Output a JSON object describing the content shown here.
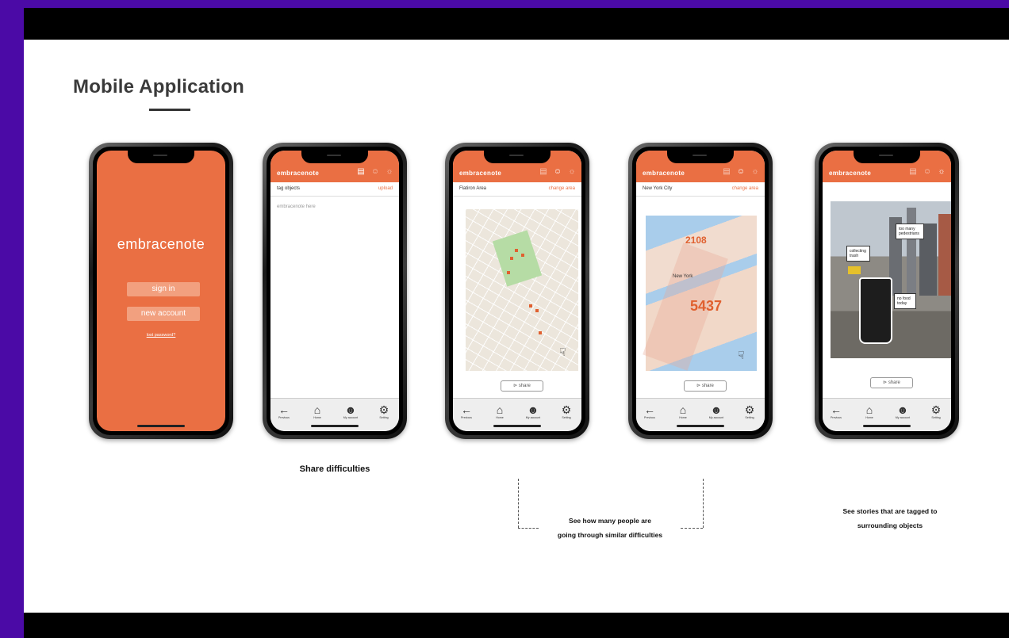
{
  "title": "Mobile Application",
  "phones": {
    "login": {
      "brand": "embracenote",
      "sign_in": "sign in",
      "new_account": "new account",
      "lost_password": "lost password?"
    },
    "tag": {
      "brand": "embracenote",
      "sub_left": "tag objects",
      "sub_right": "upload",
      "placeholder": "embracenote here"
    },
    "flatiron": {
      "brand": "embracenote",
      "sub_left": "Flatiron Area",
      "sub_right": "change area",
      "share": "share"
    },
    "nyc": {
      "brand": "embracenote",
      "sub_left": "New York City",
      "sub_right": "change area",
      "num1": "2108",
      "num2": "5437",
      "map_label": "New York",
      "share": "share"
    },
    "stories": {
      "brand": "embracenote",
      "bubble1": "collecting trash",
      "bubble2": "too many pedestrians",
      "bubble3": "no food today",
      "share": "share"
    }
  },
  "nav": {
    "previous": "Previous",
    "home": "Home",
    "account": "My account",
    "setting": "Setting"
  },
  "captions": {
    "share": "Share difficulties",
    "see_many_1": "See how many people are",
    "see_many_2": "going through similar difficulties",
    "stories_1": "See stories that are tagged to",
    "stories_2": "surrounding objects"
  }
}
